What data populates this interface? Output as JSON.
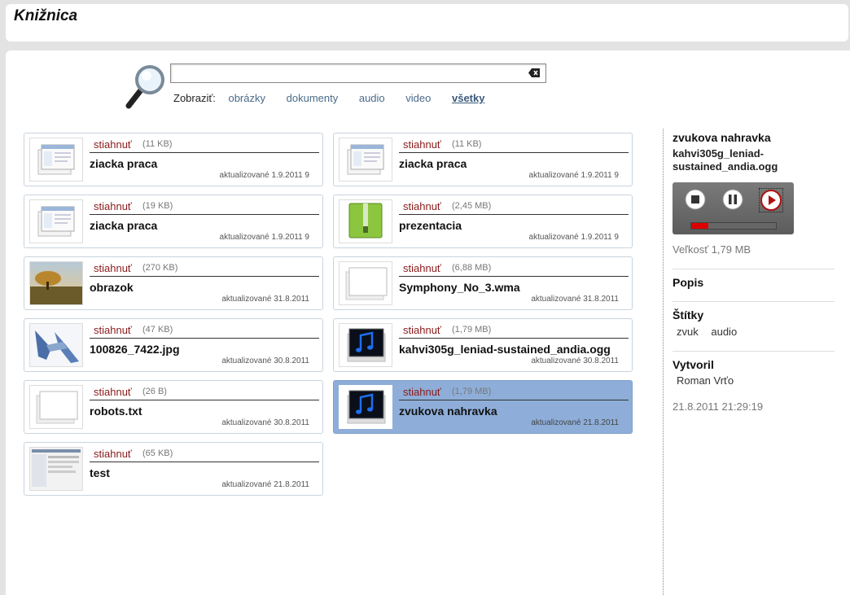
{
  "header": {
    "title": "Knižnica"
  },
  "search": {
    "value": "",
    "placeholder": ""
  },
  "filters": {
    "label": "Zobraziť:",
    "items": [
      "obrázky",
      "dokumenty",
      "audio",
      "video",
      "všetky"
    ],
    "active": "všetky"
  },
  "files": [
    {
      "download": "stiahnuť",
      "size": "(11 KB)",
      "name": "ziacka praca",
      "updated": "aktualizované 1.9.2011 9",
      "thumb": "document-icon"
    },
    {
      "download": "stiahnuť",
      "size": "(11 KB)",
      "name": "ziacka praca",
      "updated": "aktualizované 1.9.2011 9",
      "thumb": "document-icon"
    },
    {
      "download": "stiahnuť",
      "size": "(19 KB)",
      "name": "ziacka praca",
      "updated": "aktualizované 1.9.2011 9",
      "thumb": "document-icon"
    },
    {
      "download": "stiahnuť",
      "size": "(2,45 MB)",
      "name": "prezentacia",
      "updated": "aktualizované 1.9.2011 9",
      "thumb": "archive-icon"
    },
    {
      "download": "stiahnuť",
      "size": "(270 KB)",
      "name": "obrazok",
      "updated": "aktualizované 31.8.2011",
      "thumb": "landscape-photo"
    },
    {
      "download": "stiahnuť",
      "size": "(6,88 MB)",
      "name": "Symphony_No_3.wma",
      "updated": "aktualizované 31.8.2011",
      "thumb": "blank-file-icon"
    },
    {
      "download": "stiahnuť",
      "size": "(47 KB)",
      "name": "100826_7422.jpg",
      "updated": "aktualizované 30.8.2011",
      "thumb": "photo-thumbnail"
    },
    {
      "download": "stiahnuť",
      "size": "(1,79 MB)",
      "name": "kahvi305g_leniad-sustained_andia.ogg",
      "updated": "aktualizované 30.8.2011",
      "thumb": "music-icon"
    },
    {
      "download": "stiahnuť",
      "size": "(26 B)",
      "name": "robots.txt",
      "updated": "aktualizované 30.8.2011",
      "thumb": "blank-file-icon"
    },
    {
      "download": "stiahnuť",
      "size": "(1,79 MB)",
      "name": "zvukova nahravka",
      "updated": "aktualizované 21.8.2011",
      "thumb": "music-icon",
      "selected": true
    },
    {
      "download": "stiahnuť",
      "size": "(65 KB)",
      "name": "test",
      "updated": "aktualizované 21.8.2011",
      "thumb": "screenshot-thumbnail"
    }
  ],
  "detail": {
    "title": "zvukova nahravka",
    "filename": "kahvi305g_leniad-sustained_andia.ogg",
    "player": {
      "progress": 0.2
    },
    "size": "Veľkosť 1,79 MB",
    "description_heading": "Popis",
    "tags_heading": "Štítky",
    "tags": [
      "zvuk",
      "audio"
    ],
    "author_heading": "Vytvoril",
    "author": "Roman Vrťo",
    "created": "21.8.2011 21:29:19"
  },
  "colors": {
    "download": "#8b1a1a",
    "selected": "#8eaed9",
    "link": "#4a6a8a"
  }
}
